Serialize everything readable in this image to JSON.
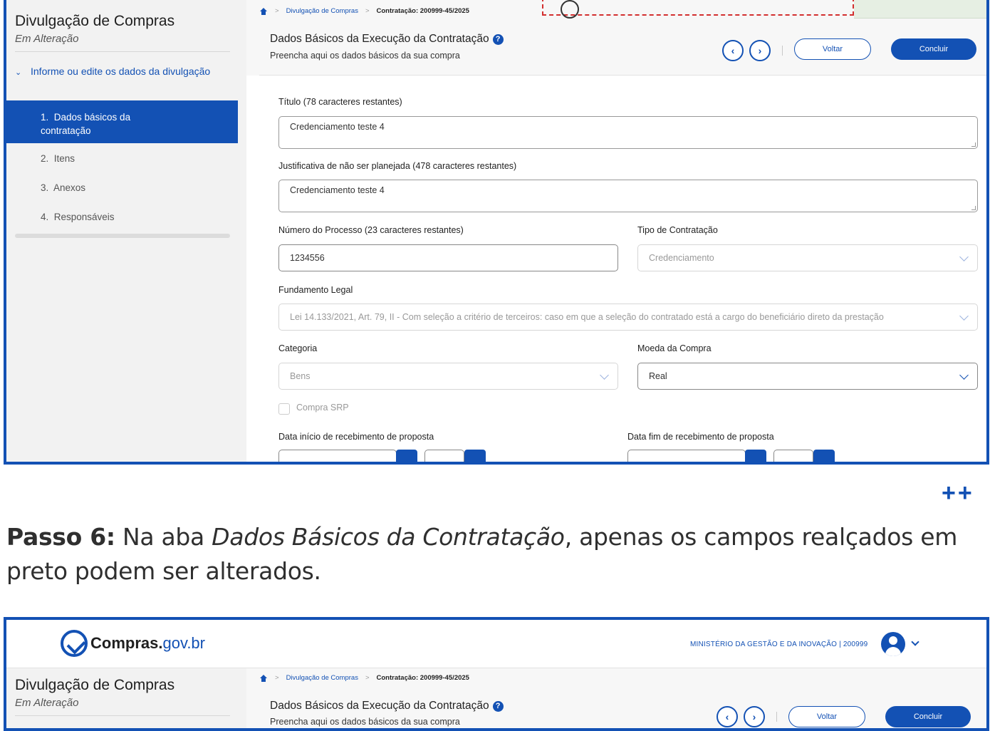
{
  "screen1": {
    "sidebar": {
      "title": "Divulgação de Compras",
      "subtitle": "Em Alteração",
      "group_label": "Informe ou edite os dados da divulgação",
      "items": [
        {
          "label": "1.  Dados básicos da contratação",
          "active": true
        },
        {
          "label": "2.  Itens"
        },
        {
          "label": "3.  Anexos"
        },
        {
          "label": "4.  Responsáveis"
        }
      ]
    },
    "breadcrumb": {
      "link": "Divulgação de Compras",
      "current": "Contratação: 200999-45/2025"
    },
    "header": {
      "title": "Dados Básicos da Execução da Contratação",
      "subtitle": "Preencha aqui os dados básicos da sua compra",
      "prev": "‹",
      "next": "›",
      "voltar": "Voltar",
      "concluir": "Concluir"
    },
    "form": {
      "titulo_label": "Título (78 caracteres restantes)",
      "titulo_value": "Credenciamento teste 4",
      "justificativa_label": "Justificativa de não ser planejada (478 caracteres restantes)",
      "justificativa_value": "Credenciamento teste 4",
      "processo_label": "Número do Processo (23 caracteres restantes)",
      "processo_value": "1234556",
      "tipo_label": "Tipo de Contratação",
      "tipo_value": "Credenciamento",
      "fundamento_label": "Fundamento Legal",
      "fundamento_value": "Lei 14.133/2021, Art. 79, II - Com seleção a critério de terceiros: caso em que a seleção do contratado está a cargo do beneficiário direto da prestação",
      "categoria_label": "Categoria",
      "categoria_value": "Bens",
      "moeda_label": "Moeda da Compra",
      "moeda_value": "Real",
      "srp_label": "Compra SRP",
      "data_inicio_label": "Data início de recebimento de proposta",
      "data_fim_label": "Data fim de recebimento de proposta"
    }
  },
  "decor": "++",
  "passo": {
    "bold": "Passo 6:",
    "text1": " Na aba ",
    "italic": "Dados Básicos da Contratação",
    "text2": ", apenas os campos realçados em preto podem ser alterados."
  },
  "screen2": {
    "logo_text": "Compras.",
    "logo_gov": "gov.br",
    "ministry": "MINISTÉRIO DA GESTÃO E DA INOVAÇÃO | 200999",
    "sidebar_title": "Divulgação de Compras",
    "sidebar_subtitle": "Em Alteração",
    "breadcrumb_link": "Divulgação de Compras",
    "breadcrumb_current": "Contratação: 200999-45/2025",
    "header_title": "Dados Básicos da Execução da Contratação",
    "header_subtitle": "Preencha aqui os dados básicos da sua compra",
    "prev": "‹",
    "next": "›",
    "voltar": "Voltar",
    "concluir": "Concluir"
  }
}
